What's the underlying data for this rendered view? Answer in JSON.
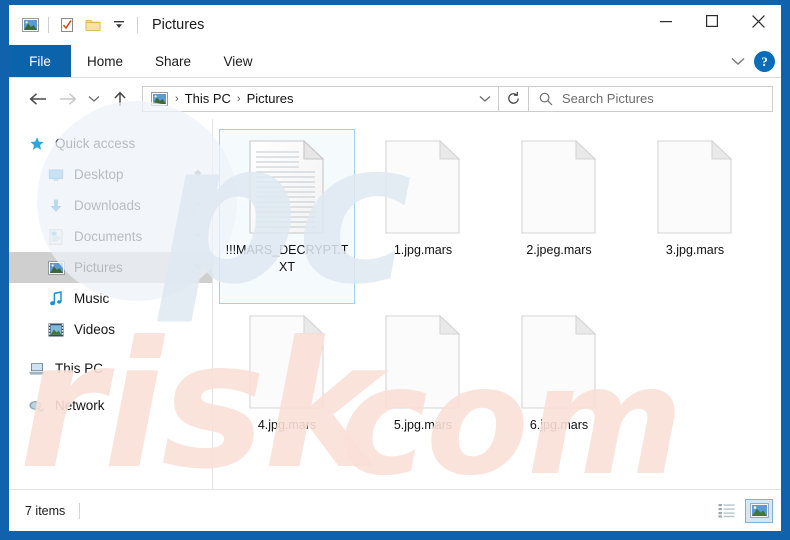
{
  "window": {
    "title": "Pictures",
    "accent_color": "#0f62ab",
    "quick_access_toolbar": [
      {
        "name": "pictures-folder-icon",
        "label": "Pictures"
      },
      {
        "name": "properties-icon",
        "label": "Properties"
      },
      {
        "name": "new-folder-icon",
        "label": "New folder"
      },
      {
        "name": "customize-qat-icon",
        "label": "Customize Quick Access Toolbar"
      }
    ],
    "controls": {
      "minimize": "Minimize",
      "maximize": "Maximize",
      "close": "Close"
    }
  },
  "ribbon": {
    "tabs": [
      {
        "label": "File",
        "selected": true
      },
      {
        "label": "Home",
        "selected": false
      },
      {
        "label": "Share",
        "selected": false
      },
      {
        "label": "View",
        "selected": false
      }
    ],
    "expand_label": "Expand the Ribbon",
    "help_label": "?"
  },
  "navigation": {
    "back": "Back",
    "forward": "Forward",
    "recent": "Recent locations",
    "up": "Up",
    "breadcrumb": {
      "icon": "pictures-icon",
      "parts": [
        "This PC",
        "Pictures"
      ],
      "separator": "›",
      "dropdown": "Previous Locations"
    },
    "refresh": "Refresh",
    "search": {
      "placeholder": "Search Pictures",
      "value": ""
    }
  },
  "sidebar": {
    "items": [
      {
        "label": "Quick access",
        "icon": "star-icon",
        "indent": 0,
        "pinned": false,
        "selected": false
      },
      {
        "label": "Desktop",
        "icon": "desktop-icon",
        "indent": 1,
        "pinned": true,
        "selected": false
      },
      {
        "label": "Downloads",
        "icon": "download-icon",
        "indent": 1,
        "pinned": true,
        "selected": false
      },
      {
        "label": "Documents",
        "icon": "documents-icon",
        "indent": 1,
        "pinned": true,
        "selected": false
      },
      {
        "label": "Pictures",
        "icon": "pictures-icon",
        "indent": 1,
        "pinned": true,
        "selected": true
      },
      {
        "label": "Music",
        "icon": "music-icon",
        "indent": 1,
        "pinned": false,
        "selected": false
      },
      {
        "label": "Videos",
        "icon": "videos-icon",
        "indent": 1,
        "pinned": false,
        "selected": false
      },
      {
        "label": "This PC",
        "icon": "pc-icon",
        "indent": 0,
        "pinned": false,
        "selected": false
      },
      {
        "label": "Network",
        "icon": "network-icon",
        "indent": 0,
        "pinned": false,
        "selected": false
      }
    ]
  },
  "files": [
    {
      "name": "!!!MARS_DECRYPT.TXT",
      "icon": "text-file-icon",
      "selected": true
    },
    {
      "name": "1.jpg.mars",
      "icon": "blank-file-icon",
      "selected": false
    },
    {
      "name": "2.jpeg.mars",
      "icon": "blank-file-icon",
      "selected": false
    },
    {
      "name": "3.jpg.mars",
      "icon": "blank-file-icon",
      "selected": false
    },
    {
      "name": "4.jpg.mars",
      "icon": "blank-file-icon",
      "selected": false
    },
    {
      "name": "5.jpg.mars",
      "icon": "blank-file-icon",
      "selected": false
    },
    {
      "name": "6.jpg.mars",
      "icon": "blank-file-icon",
      "selected": false
    }
  ],
  "status": {
    "item_count": "7 items",
    "views": [
      {
        "name": "details-view",
        "label": "Details",
        "active": false
      },
      {
        "name": "large-icons-view",
        "label": "Large icons",
        "active": true
      }
    ]
  }
}
